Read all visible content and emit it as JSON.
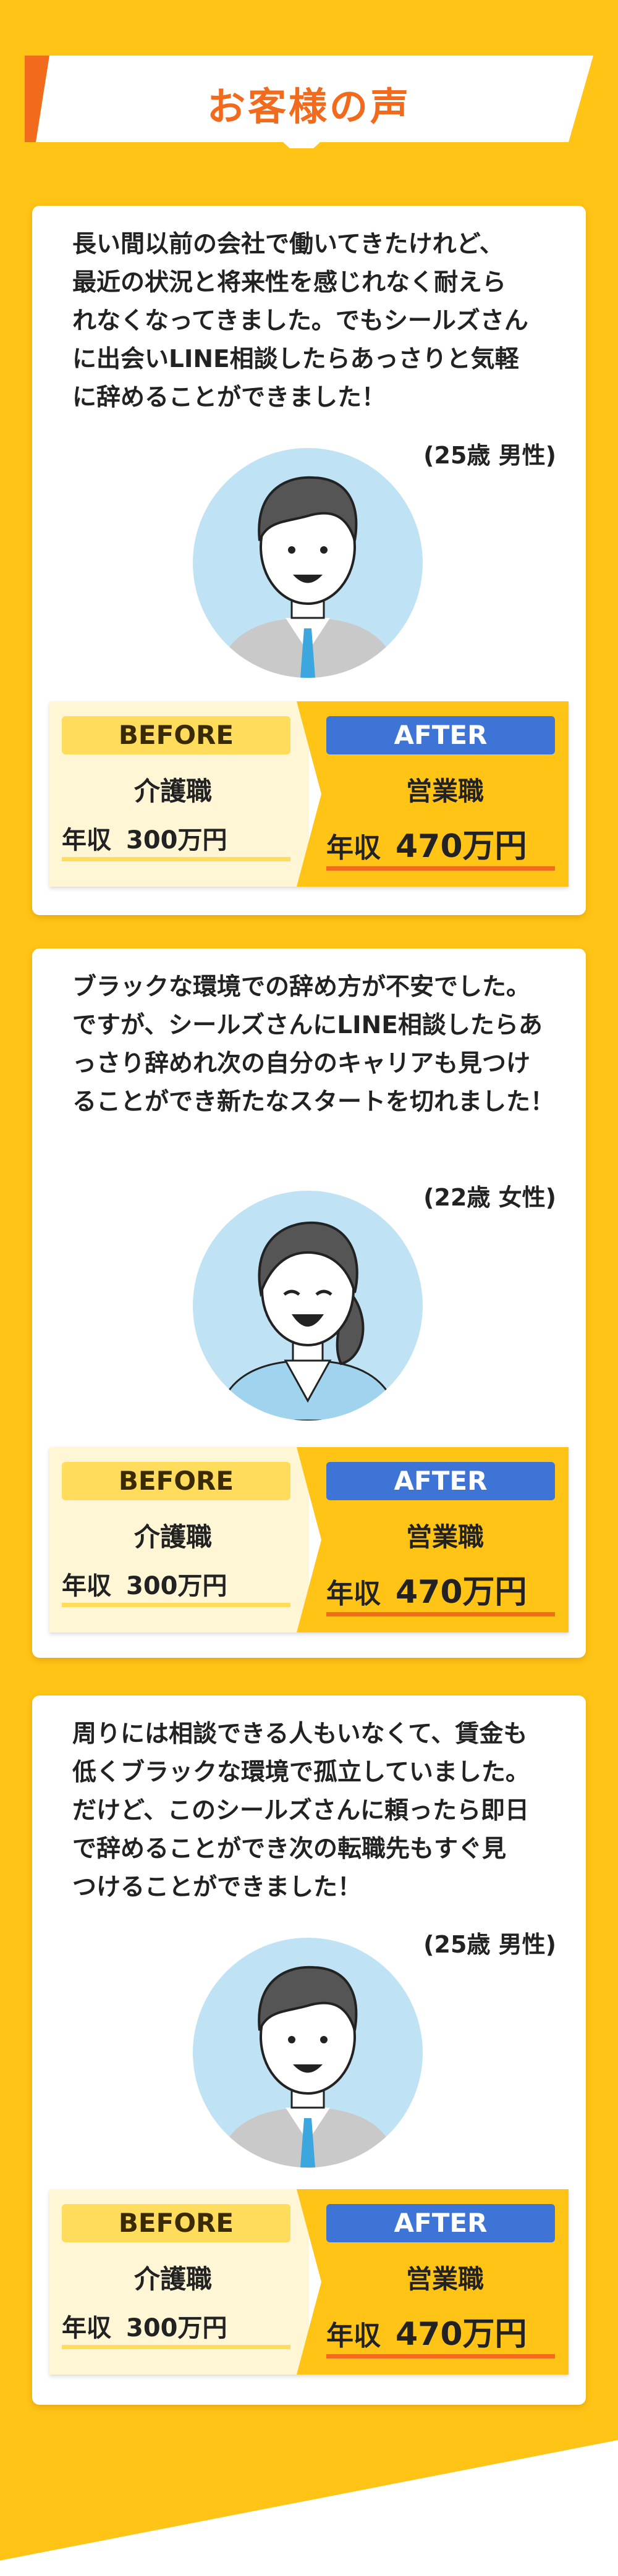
{
  "header": {
    "title": "お客様の声"
  },
  "colors": {
    "background": "#FFC416",
    "accent": "#F26A1B",
    "after_pill": "#3D74D6",
    "before_pill": "#FFDC5C"
  },
  "testimonials": [
    {
      "quote": "長い間以前の会社で働いてきたけれど、\n最近の状況と将来性を感じれなく耐えら\nれなくなってきました。でもシールズさん\nに出会いLINE相談したらあっさりと気軽\nに辞めることができました！",
      "age": "(25歳 男性)",
      "avatar": "male-avatar-icon",
      "before_label": "BEFORE",
      "after_label": "AFTER",
      "before_job": "介護職",
      "after_job": "営業職",
      "before_salary_label": "年収",
      "before_salary": "300万円",
      "after_salary_label": "年収",
      "after_salary": "470万円"
    },
    {
      "quote": "ブラックな環境での辞め方が不安でした。\nですが、シールズさんにLINE相談したらあ\nっさり辞めれ次の自分のキャリアも見つけ\nることができ新たなスタートを切れました！",
      "age": "(22歳 女性)",
      "avatar": "female-avatar-icon",
      "before_label": "BEFORE",
      "after_label": "AFTER",
      "before_job": "介護職",
      "after_job": "営業職",
      "before_salary_label": "年収",
      "before_salary": "300万円",
      "after_salary_label": "年収",
      "after_salary": "470万円"
    },
    {
      "quote": "周りには相談できる人もいなくて、賃金も\n低くブラックな環境で孤立していました。\nだけど、このシールズさんに頼ったら即日\nで辞めることができ次の転職先もすぐ見\nつけることができました！",
      "age": "(25歳 男性)",
      "avatar": "male-avatar-icon",
      "before_label": "BEFORE",
      "after_label": "AFTER",
      "before_job": "介護職",
      "after_job": "営業職",
      "before_salary_label": "年収",
      "before_salary": "300万円",
      "after_salary_label": "年収",
      "after_salary": "470万円"
    }
  ]
}
